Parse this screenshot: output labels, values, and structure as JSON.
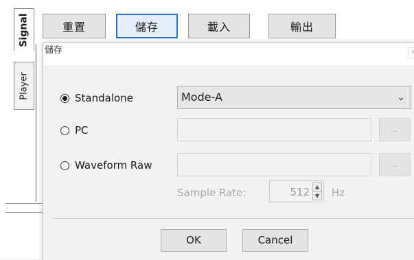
{
  "tabs": {
    "signal": "Signal",
    "player": "Player"
  },
  "toolbar": {
    "reset": "重置",
    "save": "儲存",
    "load": "載入",
    "export": "輸出"
  },
  "dialog": {
    "title": "儲存",
    "close_icon": "close-icon",
    "options": {
      "standalone": "Standalone",
      "pc": "PC",
      "waveform_raw": "Waveform Raw"
    },
    "selected_option": "standalone",
    "mode_select": {
      "value": "Mode-A"
    },
    "pc_path": "",
    "waveform_path": "",
    "browse_label": "...",
    "sample_rate": {
      "label": "Sample Rate:",
      "value": "512",
      "unit": "Hz"
    },
    "ok": "OK",
    "cancel": "Cancel"
  }
}
